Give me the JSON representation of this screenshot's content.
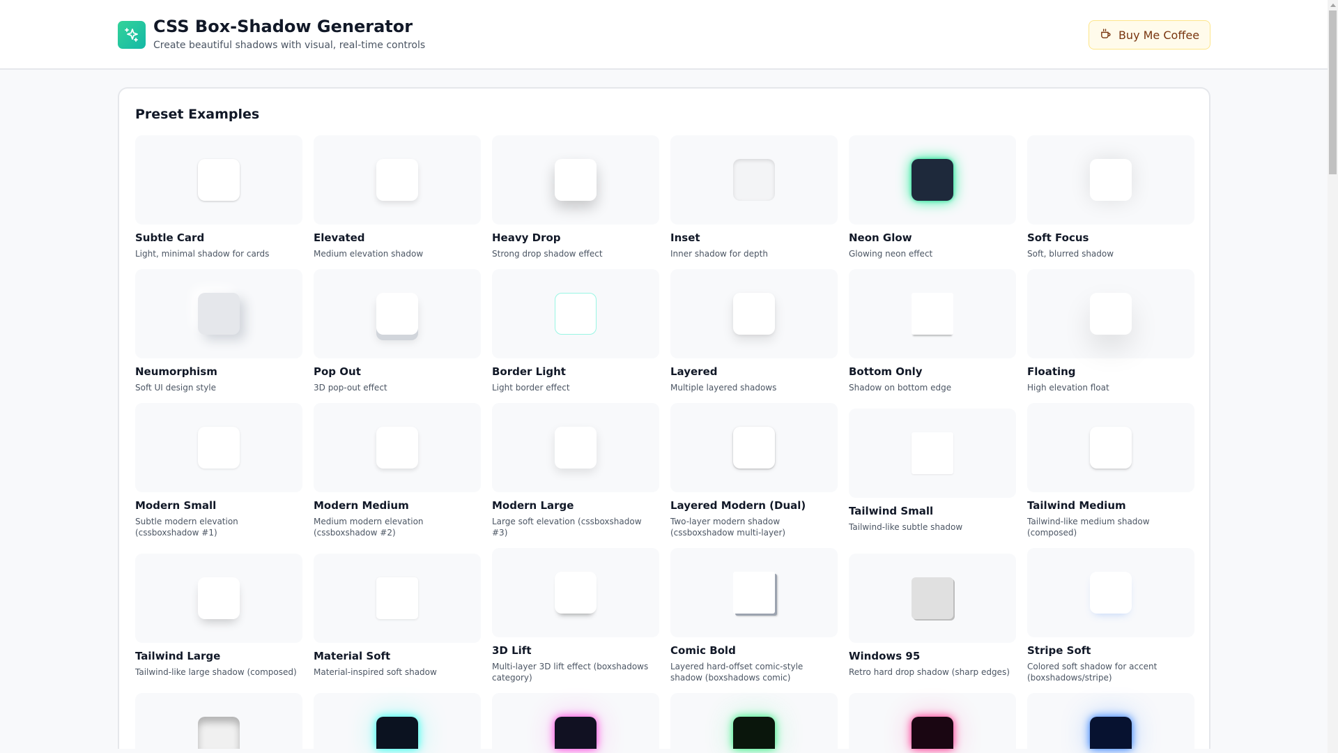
{
  "header": {
    "title": "CSS Box-Shadow Generator",
    "subtitle": "Create beautiful shadows with visual, real-time controls",
    "coffee_label": "Buy Me Coffee"
  },
  "presets": {
    "heading": "Preset Examples",
    "items": [
      {
        "name": "Subtle Card",
        "desc": "Light, minimal shadow for cards"
      },
      {
        "name": "Elevated",
        "desc": "Medium elevation shadow"
      },
      {
        "name": "Heavy Drop",
        "desc": "Strong drop shadow effect"
      },
      {
        "name": "Inset",
        "desc": "Inner shadow for depth"
      },
      {
        "name": "Neon Glow",
        "desc": "Glowing neon effect"
      },
      {
        "name": "Soft Focus",
        "desc": "Soft, blurred shadow"
      },
      {
        "name": "Neumorphism",
        "desc": "Soft UI design style"
      },
      {
        "name": "Pop Out",
        "desc": "3D pop-out effect"
      },
      {
        "name": "Border Light",
        "desc": "Light border effect"
      },
      {
        "name": "Layered",
        "desc": "Multiple layered shadows"
      },
      {
        "name": "Bottom Only",
        "desc": "Shadow on bottom edge"
      },
      {
        "name": "Floating",
        "desc": "High elevation float"
      },
      {
        "name": "Modern Small",
        "desc": "Subtle modern elevation (cssboxshadow #1)"
      },
      {
        "name": "Modern Medium",
        "desc": "Medium modern elevation (cssboxshadow #2)"
      },
      {
        "name": "Modern Large",
        "desc": "Large soft elevation (cssboxshadow #3)"
      },
      {
        "name": "Layered Modern (Dual)",
        "desc": "Two-layer modern shadow (cssboxshadow multi-layer)"
      },
      {
        "name": "Tailwind Small",
        "desc": "Tailwind-like subtle shadow"
      },
      {
        "name": "Tailwind Medium",
        "desc": "Tailwind-like medium shadow (composed)"
      },
      {
        "name": "Tailwind Large",
        "desc": "Tailwind-like large shadow (composed)"
      },
      {
        "name": "Material Soft",
        "desc": "Material-inspired soft shadow"
      },
      {
        "name": "3D Lift",
        "desc": "Multi-layer 3D lift effect (boxshadows category)"
      },
      {
        "name": "Comic Bold",
        "desc": "Layered hard-offset comic-style shadow (boxshadows comic)"
      },
      {
        "name": "Windows 95",
        "desc": "Retro hard drop shadow (sharp edges)"
      },
      {
        "name": "Stripe Soft",
        "desc": "Colored soft shadow for accent (boxshadows/stripe)"
      },
      {},
      {},
      {},
      {},
      {},
      {}
    ]
  }
}
